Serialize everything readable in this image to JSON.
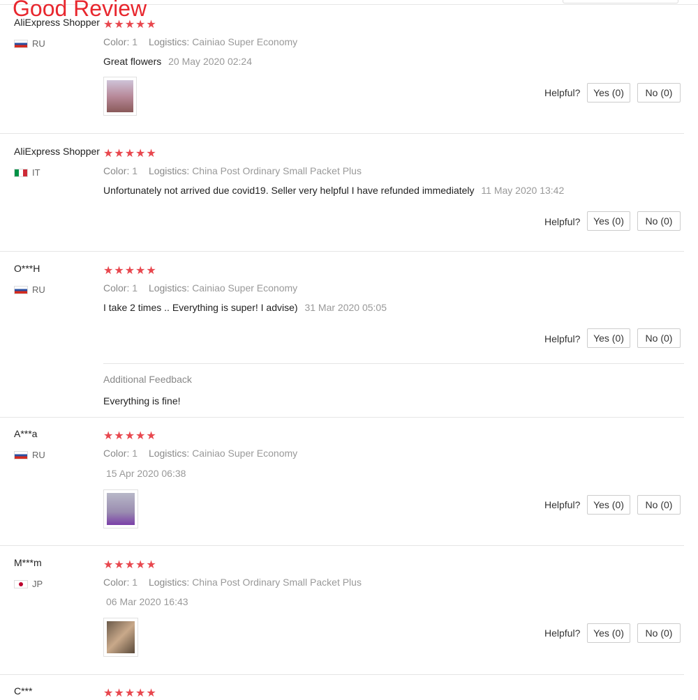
{
  "header_label": "Good Review",
  "accent_color": "#e8272e",
  "star_color": "#e8474e",
  "labels": {
    "color": "Color:",
    "logistics": "Logistics:",
    "helpful": "Helpful?",
    "additional_feedback": "Additional Feedback"
  },
  "reviews": [
    {
      "name": "AliExpress Shopper",
      "country": "RU",
      "flag": "ru",
      "stars": "★★★★★",
      "rating": 5,
      "color": "1",
      "logistics": "Cainiao Super Economy",
      "text": "Great flowers",
      "date": "20 May 2020 02:24",
      "yes": "Yes (0)",
      "no": "No (0)",
      "has_photo": true
    },
    {
      "name": "AliExpress Shopper",
      "country": "IT",
      "flag": "it",
      "stars": "★★★★★",
      "rating": 5,
      "color": "1",
      "logistics": "China Post Ordinary Small Packet Plus",
      "text": "Unfortunately not arrived due covid19. Seller very helpful I have refunded immediately",
      "date": "11 May 2020 13:42",
      "yes": "Yes (0)",
      "no": "No (0)",
      "has_photo": false
    },
    {
      "name": "O***H",
      "country": "RU",
      "flag": "ru",
      "stars": "★★★★★",
      "rating": 5,
      "color": "1",
      "logistics": "Cainiao Super Economy",
      "text": "I take 2 times .. Everything is super! I advise)",
      "date": "31 Mar 2020 05:05",
      "yes": "Yes (0)",
      "no": "No (0)",
      "has_photo": false,
      "additional_feedback": "Everything is fine!"
    },
    {
      "name": "A***a",
      "country": "RU",
      "flag": "ru",
      "stars": "★★★★★",
      "rating": 5,
      "color": "1",
      "logistics": "Cainiao Super Economy",
      "text": "",
      "date": "15 Apr 2020 06:38",
      "yes": "Yes (0)",
      "no": "No (0)",
      "has_photo": true
    },
    {
      "name": "M***m",
      "country": "JP",
      "flag": "jp",
      "stars": "★★★★★",
      "rating": 5,
      "color": "1",
      "logistics": "China Post Ordinary Small Packet Plus",
      "text": "",
      "date": "06 Mar 2020 16:43",
      "yes": "Yes (0)",
      "no": "No (0)",
      "has_photo": true
    },
    {
      "name": "C***",
      "stars": "★★★★★",
      "rating": 5
    }
  ]
}
